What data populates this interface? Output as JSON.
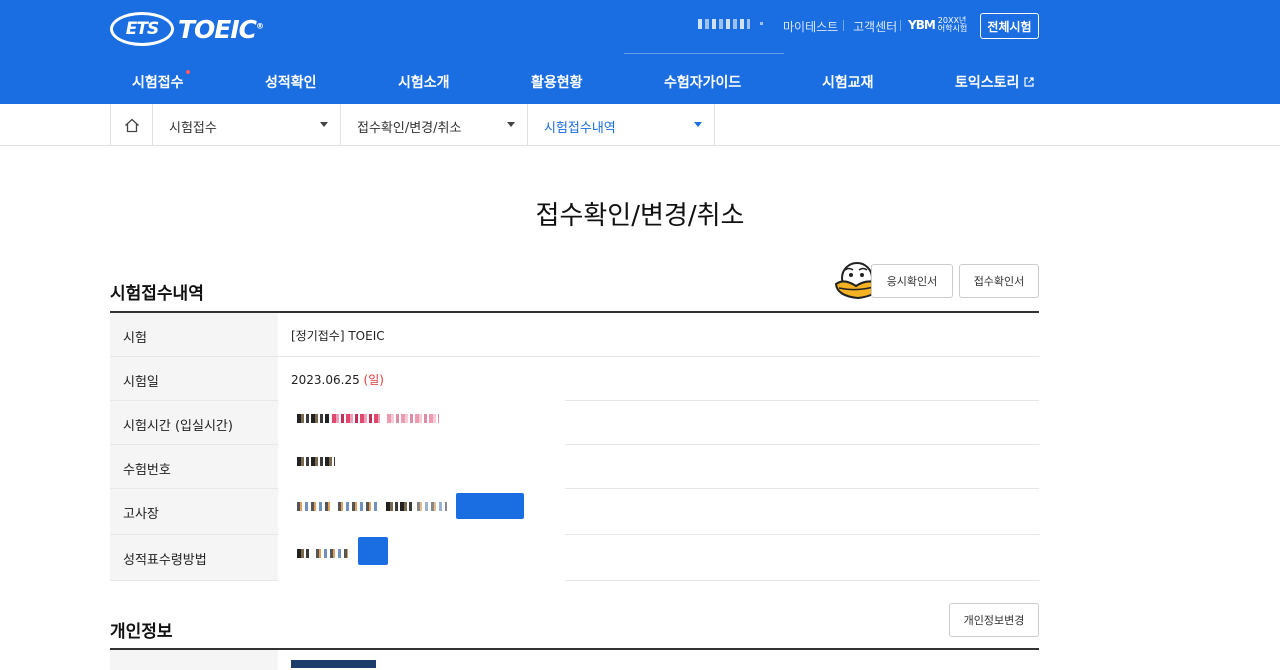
{
  "header": {
    "logo_ets": "ETS",
    "logo_toeic": "TOEIC",
    "logo_reg": "®",
    "util_links": [
      "마이테스트",
      "고객센터"
    ],
    "ybm_mark": "YBM",
    "ybm_text_line1": "20XX년",
    "ybm_text_line2": "어학시험",
    "all_exam_button": "전체시험"
  },
  "nav": {
    "items": [
      "시험접수",
      "성적확인",
      "시험소개",
      "활용현황",
      "수험자가이드",
      "시험교재",
      "토익스토리"
    ]
  },
  "breadcrumb": {
    "items": [
      "시험접수",
      "접수확인/변경/취소",
      "시험접수내역"
    ]
  },
  "page": {
    "title": "접수확인/변경/취소"
  },
  "registration": {
    "section_title": "시험접수내역",
    "buttons": [
      "응시확인서",
      "접수확인서"
    ],
    "rows": [
      {
        "label": "시험",
        "value": "[정기접수] TOEIC"
      },
      {
        "label": "시험일",
        "value": "2023.06.25",
        "day": "(일)"
      },
      {
        "label": "시험시간 (입실시간)",
        "value": ""
      },
      {
        "label": "수험번호",
        "value": ""
      },
      {
        "label": "고사장",
        "value": ""
      },
      {
        "label": "성적표수령방법",
        "value": ""
      }
    ]
  },
  "personal": {
    "section_title": "개인정보",
    "edit_button": "개인정보변경"
  },
  "colors": {
    "brand_blue": "#1a6ee2",
    "sunday_red": "#e03c3c"
  }
}
